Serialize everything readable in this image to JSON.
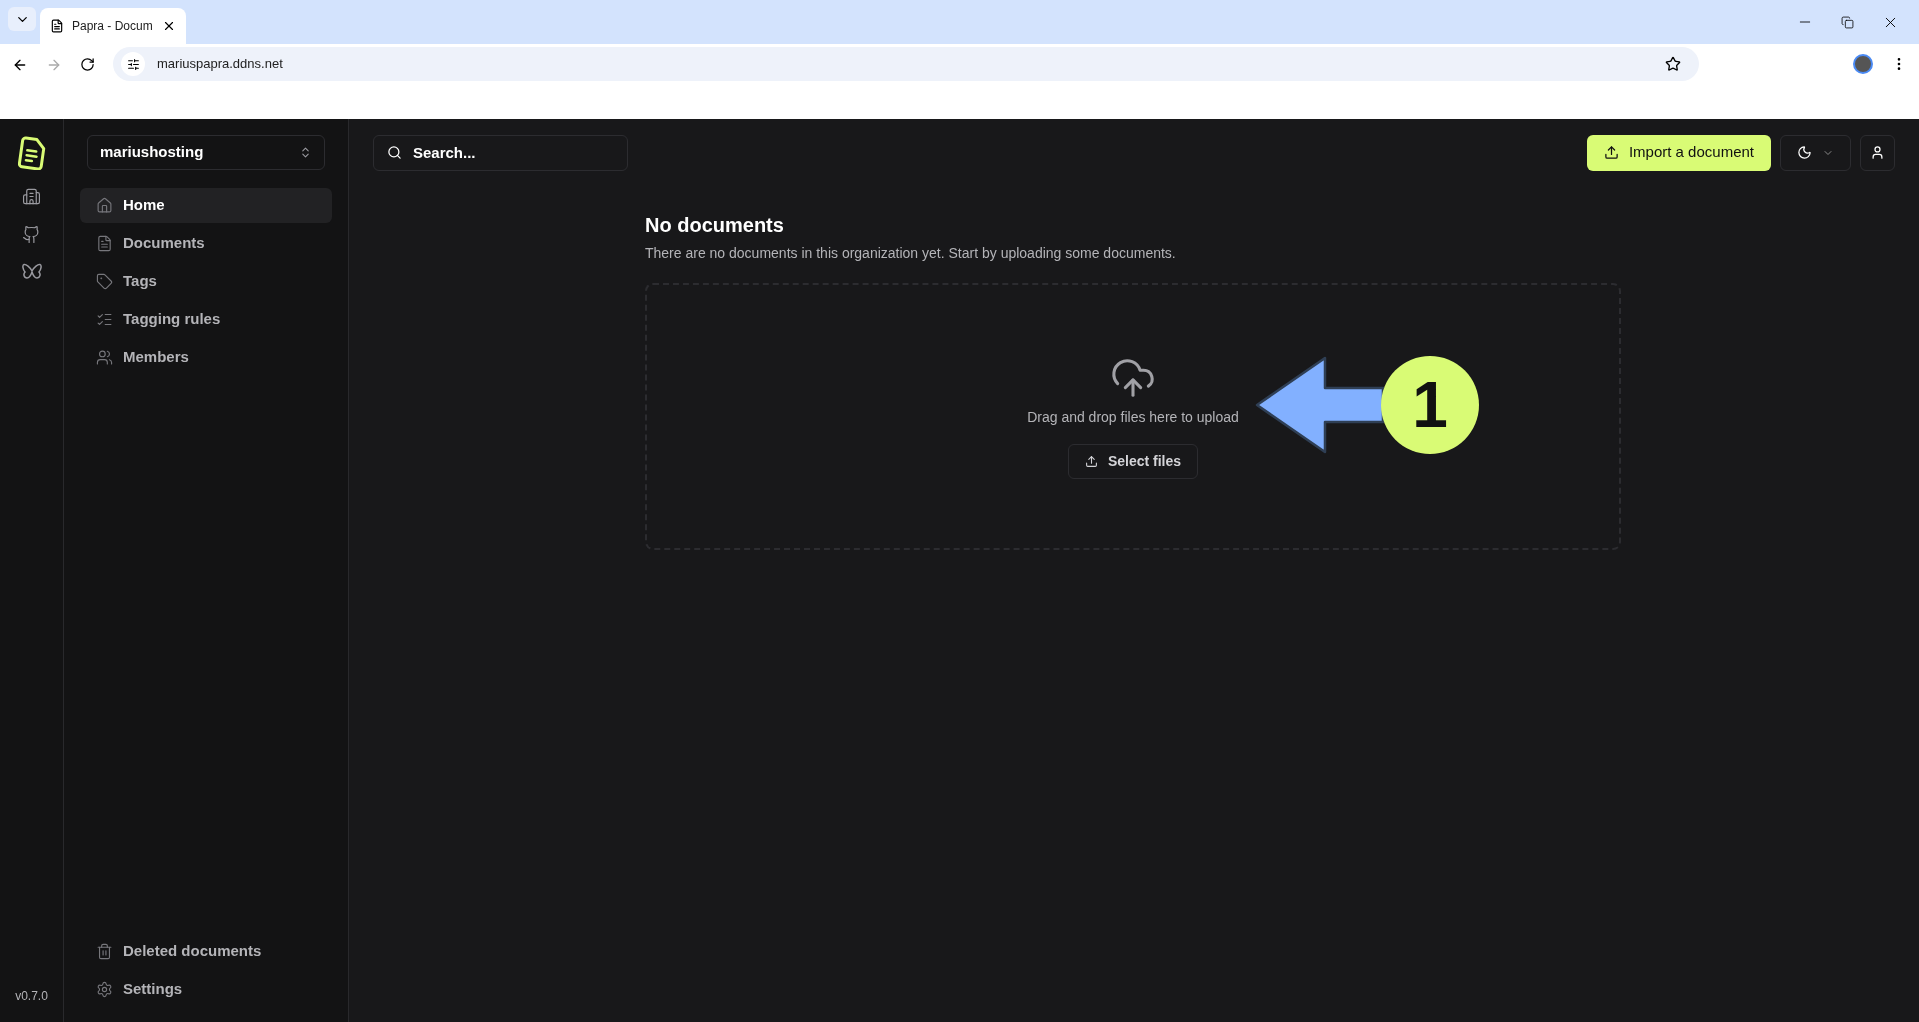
{
  "browser": {
    "tab_title": "Papra - Docum",
    "url": "mariuspapra.ddns.net"
  },
  "organization_selector": {
    "value": "mariushosting"
  },
  "nav": [
    {
      "kind": "home",
      "label": "Home",
      "selected": true
    },
    {
      "kind": "documents",
      "label": "Documents",
      "selected": false
    },
    {
      "kind": "tags",
      "label": "Tags",
      "selected": false
    },
    {
      "kind": "rules",
      "label": "Tagging rules",
      "selected": false
    },
    {
      "kind": "members",
      "label": "Members",
      "selected": false
    }
  ],
  "nav_bottom": [
    {
      "kind": "trash",
      "label": "Deleted documents",
      "selected": false
    },
    {
      "kind": "settings",
      "label": "Settings",
      "selected": false
    }
  ],
  "version": "v0.7.0",
  "search": {
    "placeholder": "Search..."
  },
  "import_button": "Import a document",
  "empty_state": {
    "title": "No documents",
    "description": "There are no documents in this organization yet. Start by uploading some documents.",
    "drop_hint": "Drag and drop files here to upload",
    "select_button": "Select files"
  },
  "annotation": {
    "number": "1"
  }
}
